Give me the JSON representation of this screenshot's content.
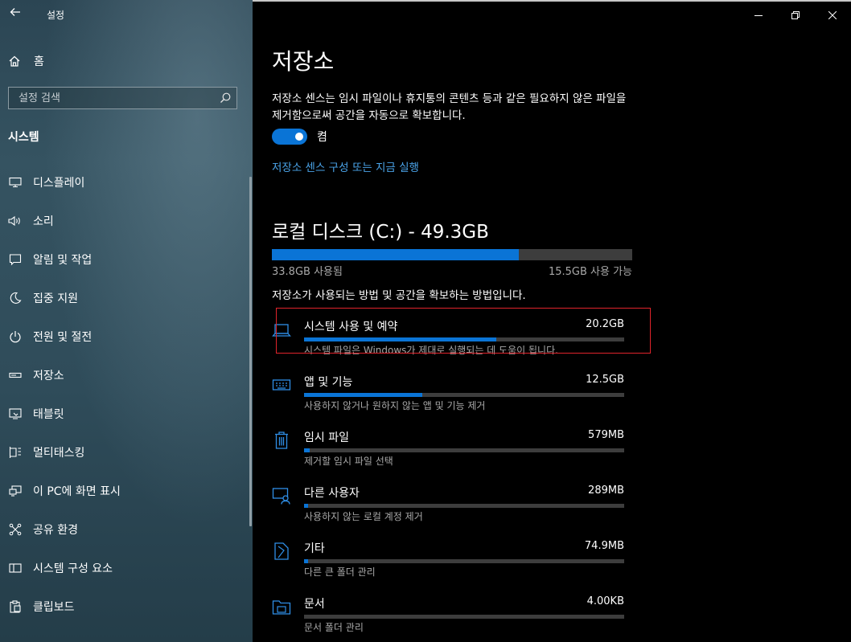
{
  "app": {
    "title": "설정"
  },
  "sidebar": {
    "home_label": "홈",
    "search_placeholder": "설정 검색",
    "section_title": "시스템",
    "items": [
      {
        "label": "디스플레이",
        "icon": "display-icon"
      },
      {
        "label": "소리",
        "icon": "speaker-icon"
      },
      {
        "label": "알림 및 작업",
        "icon": "notification-icon"
      },
      {
        "label": "집중 지원",
        "icon": "moon-icon"
      },
      {
        "label": "전원 및 절전",
        "icon": "power-icon"
      },
      {
        "label": "저장소",
        "icon": "storage-icon"
      },
      {
        "label": "태블릿",
        "icon": "tablet-icon"
      },
      {
        "label": "멀티태스킹",
        "icon": "multitasking-icon"
      },
      {
        "label": "이 PC에 화면 표시",
        "icon": "project-icon"
      },
      {
        "label": "공유 환경",
        "icon": "shared-experiences-icon"
      },
      {
        "label": "시스템 구성 요소",
        "icon": "system-components-icon"
      },
      {
        "label": "클립보드",
        "icon": "clipboard-icon"
      }
    ]
  },
  "main": {
    "title": "저장소",
    "sense_description": "저장소 센스는 임시 파일이나 휴지통의 콘텐츠 등과 같은 필요하지 않은 파일을 제거함으로써 공간을 자동으로 확보합니다.",
    "toggle": {
      "state_label": "켬",
      "on": true,
      "color": "#0a74d6"
    },
    "sense_link": "저장소 센스 구성 또는 지금 실행",
    "disk": {
      "title": "로컬 디스크 (C:) - 49.3GB",
      "used_label": "33.8GB 사용됨",
      "free_label": "15.5GB 사용 가능",
      "used_fraction": 0.686
    },
    "usage_note": "저장소가 사용되는 방법 및 공간을 확보하는 방법입니다.",
    "categories": [
      {
        "name": "시스템 사용 및 예약",
        "size": "20.2GB",
        "desc": "시스템 파일은 Windows가 제대로 실행되는 데 도움이 됩니다.",
        "fraction": 0.6,
        "icon": "laptop-icon"
      },
      {
        "name": "앱 및 기능",
        "size": "12.5GB",
        "desc": "사용하지 않거나 원하지 않는 앱 및 기능 제거",
        "fraction": 0.37,
        "icon": "keyboard-icon"
      },
      {
        "name": "임시 파일",
        "size": "579MB",
        "desc": "제거할 임시 파일 선택",
        "fraction": 0.017,
        "icon": "trash-icon"
      },
      {
        "name": "다른 사용자",
        "size": "289MB",
        "desc": "사용하지 않는 로컬 계정 제거",
        "fraction": 0.009,
        "icon": "other-users-icon"
      },
      {
        "name": "기타",
        "size": "74.9MB",
        "desc": "다른 큰 폴더 관리",
        "fraction": 0.003,
        "icon": "other-folder-icon"
      },
      {
        "name": "문서",
        "size": "4.00KB",
        "desc": "문서 폴더 관리",
        "fraction": 0.0,
        "icon": "documents-icon"
      }
    ],
    "accent_color": "#0a74d6",
    "highlight_color": "#e0242b"
  }
}
